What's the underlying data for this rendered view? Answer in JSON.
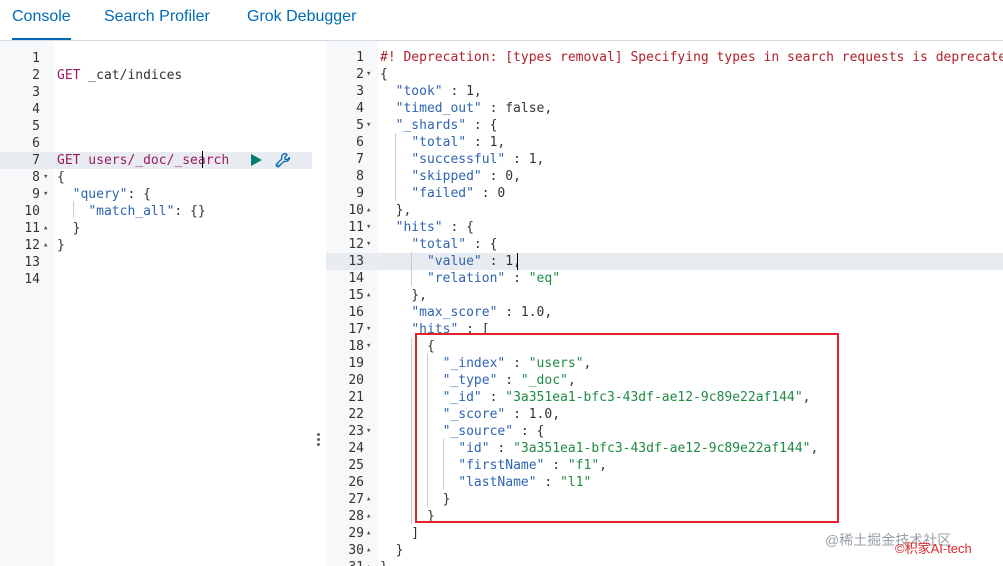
{
  "tabs": [
    {
      "label": "Console",
      "active": true
    },
    {
      "label": "Search Profiler",
      "active": false
    },
    {
      "label": "Grok Debugger",
      "active": false
    }
  ],
  "request_editor": {
    "highlighted_line": 7,
    "lines": [
      {
        "num": "1",
        "fold": "",
        "segments": []
      },
      {
        "num": "2",
        "fold": "",
        "segments": [
          {
            "t": "GET",
            "c": "m"
          },
          {
            "t": " _cat/indices",
            "c": "n"
          }
        ]
      },
      {
        "num": "3",
        "fold": "",
        "segments": []
      },
      {
        "num": "4",
        "fold": "",
        "segments": []
      },
      {
        "num": "5",
        "fold": "",
        "segments": []
      },
      {
        "num": "6",
        "fold": "",
        "segments": []
      },
      {
        "num": "7",
        "fold": "",
        "segments": [
          {
            "t": "GET",
            "c": "m"
          },
          {
            "t": " users/_doc/_search",
            "c": "m"
          }
        ]
      },
      {
        "num": "8",
        "fold": "▾",
        "segments": [
          {
            "t": "{",
            "c": "n"
          }
        ]
      },
      {
        "num": "9",
        "fold": "▾",
        "segments": [
          {
            "t": "  ",
            "c": "n"
          },
          {
            "t": "\"query\"",
            "c": "k"
          },
          {
            "t": ": {",
            "c": "n"
          }
        ]
      },
      {
        "num": "10",
        "fold": "",
        "segments": [
          {
            "t": "    ",
            "c": "n"
          },
          {
            "t": "\"match_all\"",
            "c": "k"
          },
          {
            "t": ": {}",
            "c": "n"
          }
        ]
      },
      {
        "num": "11",
        "fold": "▴",
        "segments": [
          {
            "t": "  }",
            "c": "n"
          }
        ]
      },
      {
        "num": "12",
        "fold": "▴",
        "segments": [
          {
            "t": "}",
            "c": "n"
          }
        ]
      },
      {
        "num": "13",
        "fold": "",
        "segments": []
      },
      {
        "num": "14",
        "fold": "",
        "segments": []
      }
    ]
  },
  "response_editor": {
    "highlighted_line": 13,
    "lines": [
      {
        "num": "1",
        "fold": "",
        "segments": [
          {
            "t": "#! Deprecation: [types removal] Specifying types in search requests is deprecated.",
            "c": "c"
          }
        ]
      },
      {
        "num": "2",
        "fold": "▾",
        "segments": [
          {
            "t": "{",
            "c": "n"
          }
        ]
      },
      {
        "num": "3",
        "fold": "",
        "segments": [
          {
            "t": "  ",
            "c": "n"
          },
          {
            "t": "\"took\"",
            "c": "k"
          },
          {
            "t": " : 1,",
            "c": "n"
          }
        ]
      },
      {
        "num": "4",
        "fold": "",
        "segments": [
          {
            "t": "  ",
            "c": "n"
          },
          {
            "t": "\"timed_out\"",
            "c": "k"
          },
          {
            "t": " : false,",
            "c": "n"
          }
        ]
      },
      {
        "num": "5",
        "fold": "▾",
        "segments": [
          {
            "t": "  ",
            "c": "n"
          },
          {
            "t": "\"_shards\"",
            "c": "k"
          },
          {
            "t": " : {",
            "c": "n"
          }
        ]
      },
      {
        "num": "6",
        "fold": "",
        "segments": [
          {
            "t": "    ",
            "c": "n"
          },
          {
            "t": "\"total\"",
            "c": "k"
          },
          {
            "t": " : 1,",
            "c": "n"
          }
        ]
      },
      {
        "num": "7",
        "fold": "",
        "segments": [
          {
            "t": "    ",
            "c": "n"
          },
          {
            "t": "\"successful\"",
            "c": "k"
          },
          {
            "t": " : 1,",
            "c": "n"
          }
        ]
      },
      {
        "num": "8",
        "fold": "",
        "segments": [
          {
            "t": "    ",
            "c": "n"
          },
          {
            "t": "\"skipped\"",
            "c": "k"
          },
          {
            "t": " : 0,",
            "c": "n"
          }
        ]
      },
      {
        "num": "9",
        "fold": "",
        "segments": [
          {
            "t": "    ",
            "c": "n"
          },
          {
            "t": "\"failed\"",
            "c": "k"
          },
          {
            "t": " : 0",
            "c": "n"
          }
        ]
      },
      {
        "num": "10",
        "fold": "▴",
        "segments": [
          {
            "t": "  },",
            "c": "n"
          }
        ]
      },
      {
        "num": "11",
        "fold": "▾",
        "segments": [
          {
            "t": "  ",
            "c": "n"
          },
          {
            "t": "\"hits\"",
            "c": "k"
          },
          {
            "t": " : {",
            "c": "n"
          }
        ]
      },
      {
        "num": "12",
        "fold": "▾",
        "segments": [
          {
            "t": "    ",
            "c": "n"
          },
          {
            "t": "\"total\"",
            "c": "k"
          },
          {
            "t": " : {",
            "c": "n"
          }
        ]
      },
      {
        "num": "13",
        "fold": "",
        "segments": [
          {
            "t": "      ",
            "c": "n"
          },
          {
            "t": "\"value\"",
            "c": "k"
          },
          {
            "t": " : 1,",
            "c": "n"
          }
        ]
      },
      {
        "num": "14",
        "fold": "",
        "segments": [
          {
            "t": "      ",
            "c": "n"
          },
          {
            "t": "\"relation\"",
            "c": "k"
          },
          {
            "t": " : ",
            "c": "n"
          },
          {
            "t": "\"eq\"",
            "c": "s"
          }
        ]
      },
      {
        "num": "15",
        "fold": "▴",
        "segments": [
          {
            "t": "    },",
            "c": "n"
          }
        ]
      },
      {
        "num": "16",
        "fold": "",
        "segments": [
          {
            "t": "    ",
            "c": "n"
          },
          {
            "t": "\"max_score\"",
            "c": "k"
          },
          {
            "t": " : 1.0,",
            "c": "n"
          }
        ]
      },
      {
        "num": "17",
        "fold": "▾",
        "segments": [
          {
            "t": "    ",
            "c": "n"
          },
          {
            "t": "\"hits\"",
            "c": "k"
          },
          {
            "t": " : [",
            "c": "n"
          }
        ]
      },
      {
        "num": "18",
        "fold": "▾",
        "segments": [
          {
            "t": "      {",
            "c": "n"
          }
        ]
      },
      {
        "num": "19",
        "fold": "",
        "segments": [
          {
            "t": "        ",
            "c": "n"
          },
          {
            "t": "\"_index\"",
            "c": "k"
          },
          {
            "t": " : ",
            "c": "n"
          },
          {
            "t": "\"users\"",
            "c": "s"
          },
          {
            "t": ",",
            "c": "n"
          }
        ]
      },
      {
        "num": "20",
        "fold": "",
        "segments": [
          {
            "t": "        ",
            "c": "n"
          },
          {
            "t": "\"_type\"",
            "c": "k"
          },
          {
            "t": " : ",
            "c": "n"
          },
          {
            "t": "\"_doc\"",
            "c": "s"
          },
          {
            "t": ",",
            "c": "n"
          }
        ]
      },
      {
        "num": "21",
        "fold": "",
        "segments": [
          {
            "t": "        ",
            "c": "n"
          },
          {
            "t": "\"_id\"",
            "c": "k"
          },
          {
            "t": " : ",
            "c": "n"
          },
          {
            "t": "\"3a351ea1-bfc3-43df-ae12-9c89e22af144\"",
            "c": "s"
          },
          {
            "t": ",",
            "c": "n"
          }
        ]
      },
      {
        "num": "22",
        "fold": "",
        "segments": [
          {
            "t": "        ",
            "c": "n"
          },
          {
            "t": "\"_score\"",
            "c": "k"
          },
          {
            "t": " : 1.0,",
            "c": "n"
          }
        ]
      },
      {
        "num": "23",
        "fold": "▾",
        "segments": [
          {
            "t": "        ",
            "c": "n"
          },
          {
            "t": "\"_source\"",
            "c": "k"
          },
          {
            "t": " : {",
            "c": "n"
          }
        ]
      },
      {
        "num": "24",
        "fold": "",
        "segments": [
          {
            "t": "          ",
            "c": "n"
          },
          {
            "t": "\"id\"",
            "c": "k"
          },
          {
            "t": " : ",
            "c": "n"
          },
          {
            "t": "\"3a351ea1-bfc3-43df-ae12-9c89e22af144\"",
            "c": "s"
          },
          {
            "t": ",",
            "c": "n"
          }
        ]
      },
      {
        "num": "25",
        "fold": "",
        "segments": [
          {
            "t": "          ",
            "c": "n"
          },
          {
            "t": "\"firstName\"",
            "c": "k"
          },
          {
            "t": " : ",
            "c": "n"
          },
          {
            "t": "\"f1\"",
            "c": "s"
          },
          {
            "t": ",",
            "c": "n"
          }
        ]
      },
      {
        "num": "26",
        "fold": "",
        "segments": [
          {
            "t": "          ",
            "c": "n"
          },
          {
            "t": "\"lastName\"",
            "c": "k"
          },
          {
            "t": " : ",
            "c": "n"
          },
          {
            "t": "\"l1\"",
            "c": "s"
          }
        ]
      },
      {
        "num": "27",
        "fold": "▴",
        "segments": [
          {
            "t": "        }",
            "c": "n"
          }
        ]
      },
      {
        "num": "28",
        "fold": "▴",
        "segments": [
          {
            "t": "      }",
            "c": "n"
          }
        ]
      },
      {
        "num": "29",
        "fold": "▴",
        "segments": [
          {
            "t": "    ]",
            "c": "n"
          }
        ]
      },
      {
        "num": "30",
        "fold": "▴",
        "segments": [
          {
            "t": "  }",
            "c": "n"
          }
        ]
      },
      {
        "num": "31",
        "fold": "▴",
        "segments": [
          {
            "t": "}",
            "c": "n"
          }
        ]
      }
    ]
  },
  "icons": {
    "run": "play-icon",
    "settings": "wrench-icon",
    "resize": "vertical-dots-icon"
  },
  "watermark": {
    "line1": "@稀土掘金技术社区",
    "line2": "©积家AI-tech"
  },
  "colors": {
    "tab_active": "#006bb4",
    "run_button": "#017d73",
    "annotation_box": "#e0242b",
    "string": "#1f8a43",
    "key": "#2f64b1",
    "method": "#9b1b61",
    "comment": "#b11f2c"
  }
}
